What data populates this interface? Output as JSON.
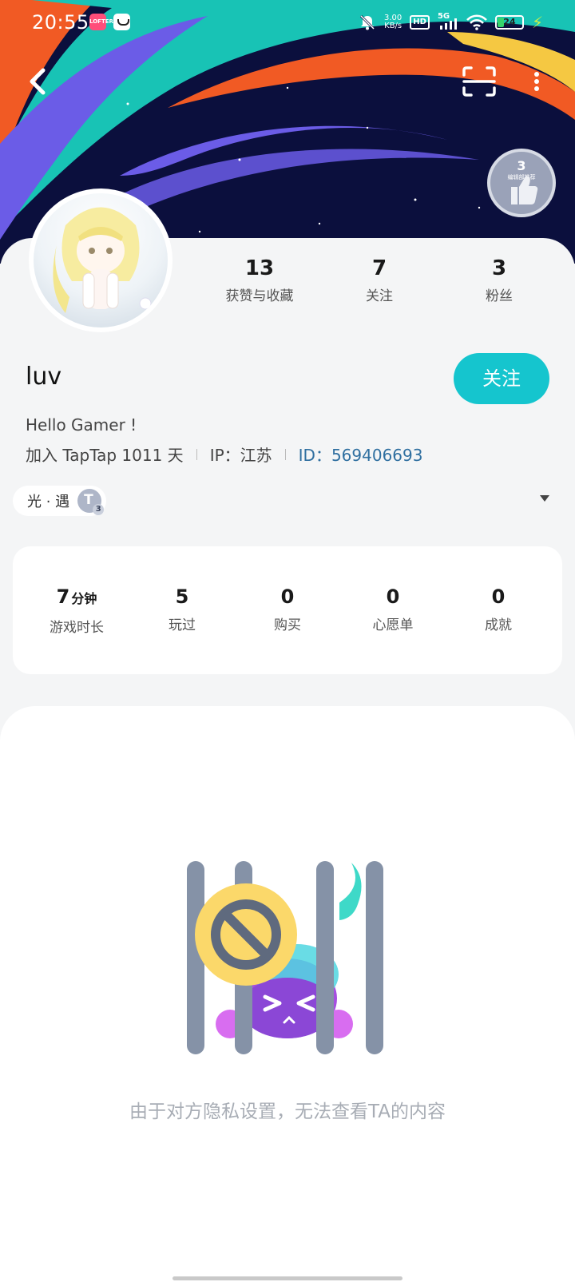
{
  "status_bar": {
    "time": "20:55",
    "net_speed_value": "3.00",
    "net_speed_unit": "KB/s",
    "hd_label": "HD",
    "signal_label": "5G",
    "battery": "24",
    "icons": [
      "lofter-app-icon",
      "bag-app-icon",
      "mute-bell-icon",
      "signal-icon",
      "wifi-icon",
      "battery-icon",
      "charging-icon"
    ]
  },
  "nav": {
    "icons": [
      "back-arrow-icon",
      "scan-icon",
      "more-dots-icon"
    ]
  },
  "level_badge": {
    "level": "3",
    "caption": "编辑部推荐"
  },
  "stats": [
    {
      "value": "13",
      "label": "获赞与收藏"
    },
    {
      "value": "7",
      "label": "关注"
    },
    {
      "value": "3",
      "label": "粉丝"
    }
  ],
  "profile": {
    "username": "luv",
    "follow_label": "关注",
    "bio": "Hello Gamer !",
    "joined": "加入 TapTap 1011 天",
    "ip": "IP：江苏",
    "id": "ID：569406693"
  },
  "tag": {
    "label": "光 · 遇"
  },
  "game_stats": [
    {
      "value": "7",
      "unit": "分钟",
      "label": "游戏时长"
    },
    {
      "value": "5",
      "unit": "",
      "label": "玩过"
    },
    {
      "value": "0",
      "unit": "",
      "label": "购买"
    },
    {
      "value": "0",
      "unit": "",
      "label": "心愿单"
    },
    {
      "value": "0",
      "unit": "",
      "label": "成就"
    }
  ],
  "privacy": {
    "message": "由于对方隐私设置，无法查看TA的内容"
  },
  "colors": {
    "accent": "#15c5ce",
    "id_link": "#2f6fa0",
    "banner_bg": "#0b0f3d",
    "stripe_orange": "#f15a24",
    "stripe_teal": "#18c3b5",
    "stripe_purple": "#6b5ce7",
    "stripe_yellow": "#f5c842"
  }
}
